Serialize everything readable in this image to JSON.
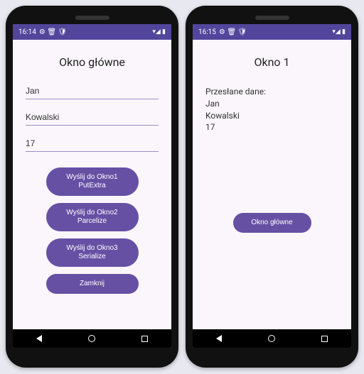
{
  "phone1": {
    "status": {
      "time": "16:14",
      "icons_left": "⚙ 🗑 🛡",
      "icons_right": "▾◢ ▮"
    },
    "title": "Okno główne",
    "inputs": {
      "name": "Jan",
      "surname": "Kowalski",
      "age": "17"
    },
    "buttons": {
      "send1": "Wyślij do Okno1\nPutExtra",
      "send2": "Wyślij do Okno2\nParcelize",
      "send3": "Wyślij do Okno3\nSerialize",
      "close": "Zamknij"
    }
  },
  "phone2": {
    "status": {
      "time": "16:15",
      "icons_left": "⚙ 🗑 🛡",
      "icons_right": "▾◢ ▮"
    },
    "title": "Okno 1",
    "received": {
      "label": "Przesłane dane:",
      "name": "Jan",
      "surname": "Kowalski",
      "age": "17"
    },
    "buttons": {
      "back": "Okno główne"
    }
  }
}
